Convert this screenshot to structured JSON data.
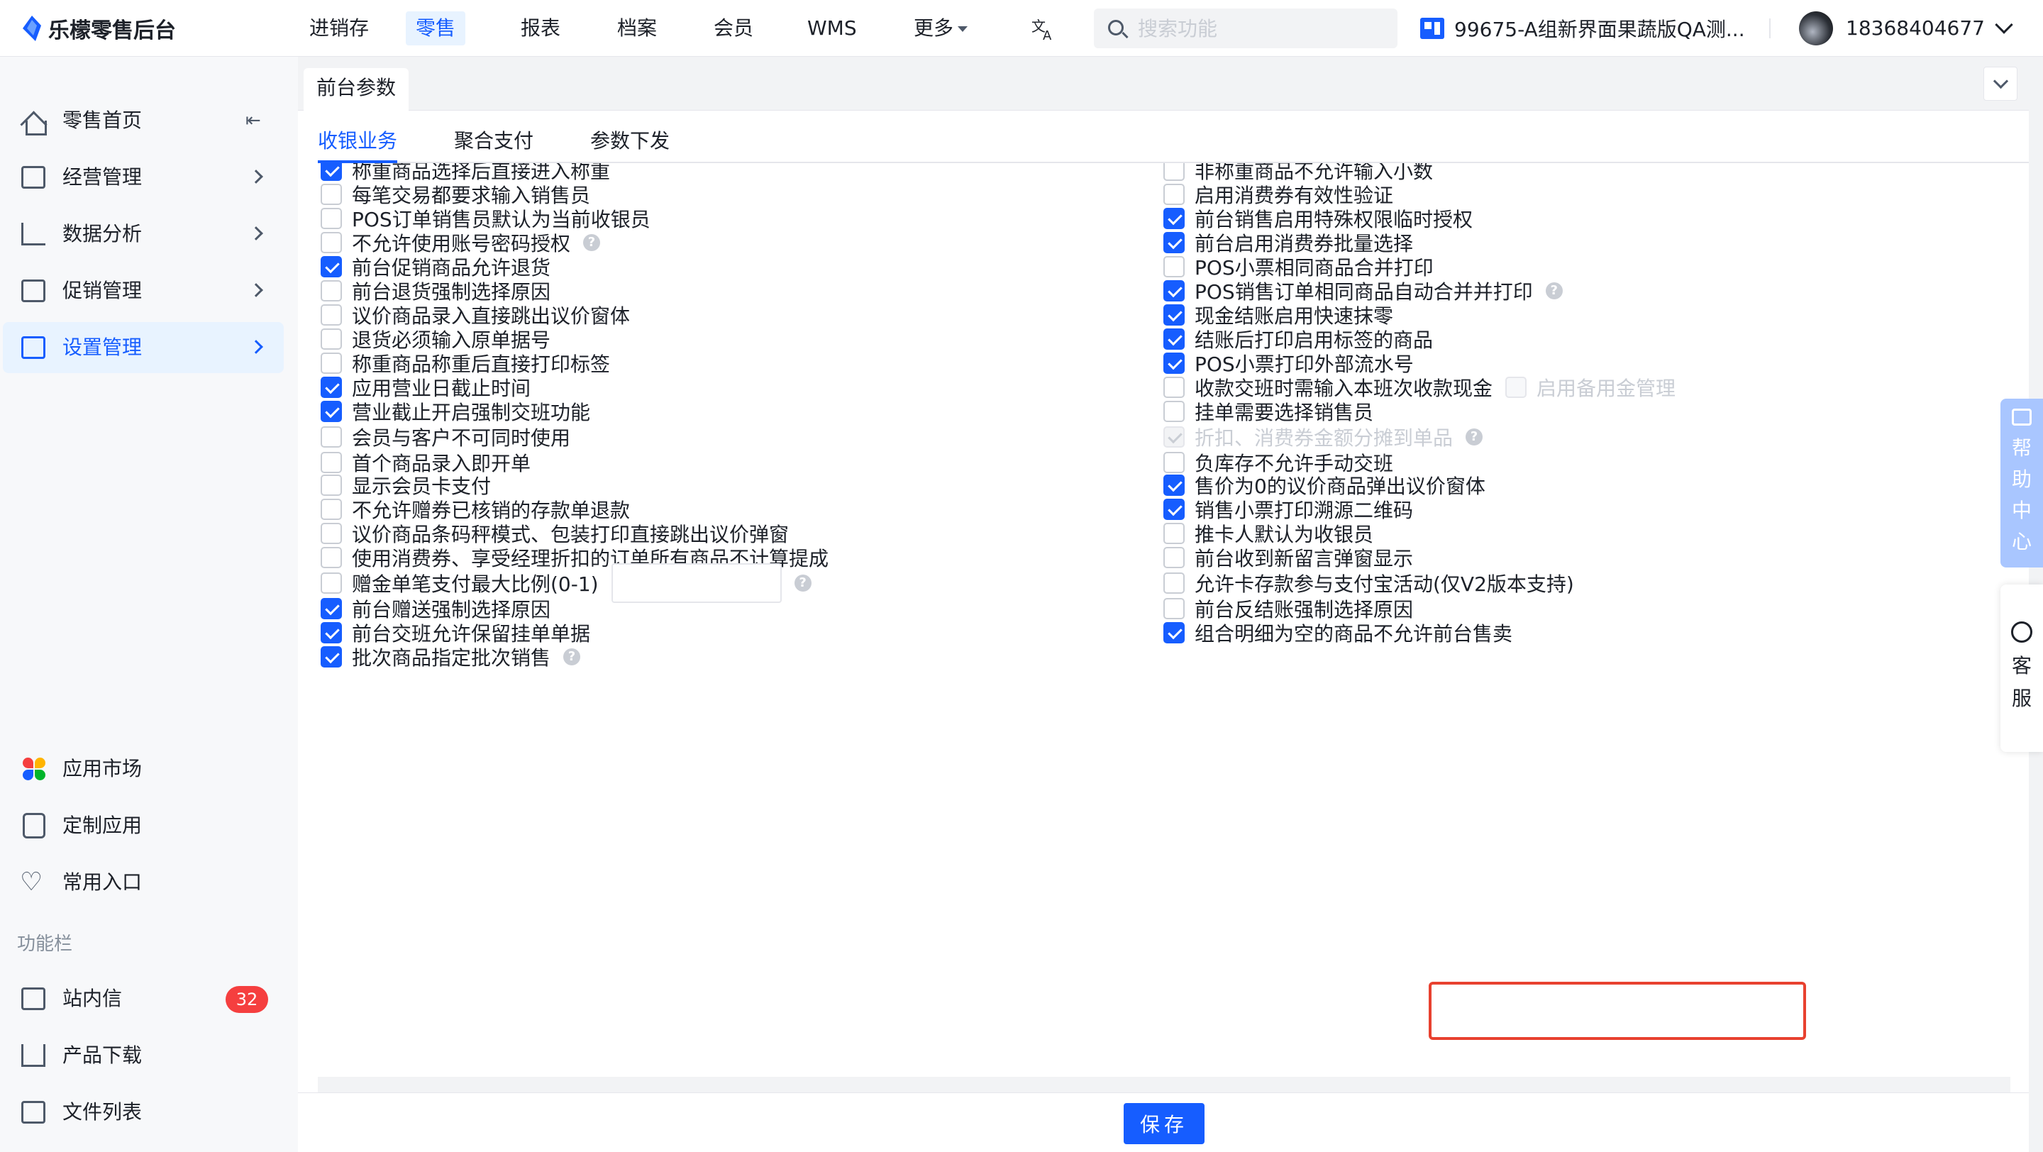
{
  "app": {
    "logo_text": "乐檬零售后台"
  },
  "nav": {
    "items": [
      "进销存",
      "零售",
      "报表",
      "档案",
      "会员",
      "WMS",
      "更多"
    ],
    "active": "零售"
  },
  "search": {
    "placeholder": "搜索功能"
  },
  "store": {
    "name": "99675-A组新界面果蔬版QA测..."
  },
  "user": {
    "phone": "18368404677"
  },
  "sidebar": {
    "items": [
      {
        "label": "零售首页"
      },
      {
        "label": "经营管理"
      },
      {
        "label": "数据分析"
      },
      {
        "label": "促销管理"
      },
      {
        "label": "设置管理"
      }
    ],
    "apps": [
      {
        "label": "应用市场"
      },
      {
        "label": "定制应用"
      },
      {
        "label": "常用入口"
      }
    ],
    "section_title": "功能栏",
    "tools": [
      {
        "label": "站内信",
        "badge": "32"
      },
      {
        "label": "产品下载"
      },
      {
        "label": "文件列表"
      }
    ]
  },
  "page_tab": {
    "label": "前台参数"
  },
  "subtabs": [
    "收银业务",
    "聚合支付",
    "参数下发"
  ],
  "options_left": [
    {
      "label": "称重商品选择后直接进入称重",
      "checked": true
    },
    {
      "label": "每笔交易都要求输入销售员",
      "checked": false
    },
    {
      "label": "POS订单销售员默认为当前收银员",
      "checked": false
    },
    {
      "label": "不允许使用账号密码授权",
      "checked": false,
      "help": "?"
    },
    {
      "label": "前台促销商品允许退货",
      "checked": true
    },
    {
      "label": "前台退货强制选择原因",
      "checked": false
    },
    {
      "label": "议价商品录入直接跳出议价窗体",
      "checked": false
    },
    {
      "label": "退货必须输入原单据号",
      "checked": false
    },
    {
      "label": "称重商品称重后直接打印标签",
      "checked": false
    },
    {
      "label": "应用营业日截止时间",
      "checked": true
    },
    {
      "label": "营业截止开启强制交班功能",
      "checked": true
    },
    {
      "label": "会员与客户不可同时使用",
      "checked": false
    },
    {
      "label": "首个商品录入即开单",
      "checked": false
    },
    {
      "label": "显示会员卡支付",
      "checked": false
    },
    {
      "label": "不允许赠券已核销的存款单退款",
      "checked": false
    },
    {
      "label": "议价商品条码秤模式、包装打印直接跳出议价弹窗",
      "checked": false
    },
    {
      "label": "使用消费券、享受经理折扣的订单所有商品不计算提成",
      "checked": false
    },
    {
      "label": "赠金单笔支付最大比例(0-1)",
      "checked": false,
      "help": "?",
      "input_value": ""
    },
    {
      "label": "前台赠送强制选择原因",
      "checked": true
    },
    {
      "label": "前台交班允许保留挂单单据",
      "checked": true
    },
    {
      "label": "批次商品指定批次销售",
      "checked": true,
      "help": "?"
    }
  ],
  "options_right": [
    {
      "label": "非称重商品不允许输入小数",
      "checked": false
    },
    {
      "label": "启用消费券有效性验证",
      "checked": false
    },
    {
      "label": "前台销售启用特殊权限临时授权",
      "checked": true
    },
    {
      "label": "前台启用消费券批量选择",
      "checked": true
    },
    {
      "label": "POS小票相同商品合并打印",
      "checked": false
    },
    {
      "label": "POS销售订单相同商品自动合并并打印",
      "checked": true,
      "help": "?"
    },
    {
      "label": "现金结账启用快速抹零",
      "checked": true
    },
    {
      "label": "结账后打印启用标签的商品",
      "checked": true
    },
    {
      "label": "POS小票打印外部流水号",
      "checked": true
    },
    {
      "label": "收款交班时需输入本班次收款现金",
      "checked": false,
      "extra_label": "启用备用金管理",
      "extra_checked": false
    },
    {
      "label": "挂单需要选择销售员",
      "checked": false
    },
    {
      "label": "折扣、消费券金额分摊到单品",
      "checked": true,
      "disabled": true,
      "help": "?"
    },
    {
      "label": "负库存不允许手动交班",
      "checked": false
    },
    {
      "label": "售价为0的议价商品弹出议价窗体",
      "checked": true
    },
    {
      "label": "销售小票打印溯源二维码",
      "checked": true
    },
    {
      "label": "推卡人默认为收银员",
      "checked": false
    },
    {
      "label": "前台收到新留言弹窗显示",
      "checked": false
    },
    {
      "label": "允许卡存款参与支付宝活动(仅V2版本支持)",
      "checked": false
    },
    {
      "label": "前台反结账强制选择原因",
      "checked": false
    },
    {
      "label": "组合明细为空的商品不允许前台售卖",
      "checked": true
    }
  ],
  "footer": {
    "save_label": "保存"
  },
  "float_help": {
    "chars": [
      "帮",
      "助",
      "中",
      "心"
    ]
  },
  "float_cs": {
    "chars": [
      "客",
      "服"
    ]
  },
  "colors": {
    "accent": "#165dff",
    "highlight": "#e8412f",
    "badge": "#f53f3f"
  }
}
